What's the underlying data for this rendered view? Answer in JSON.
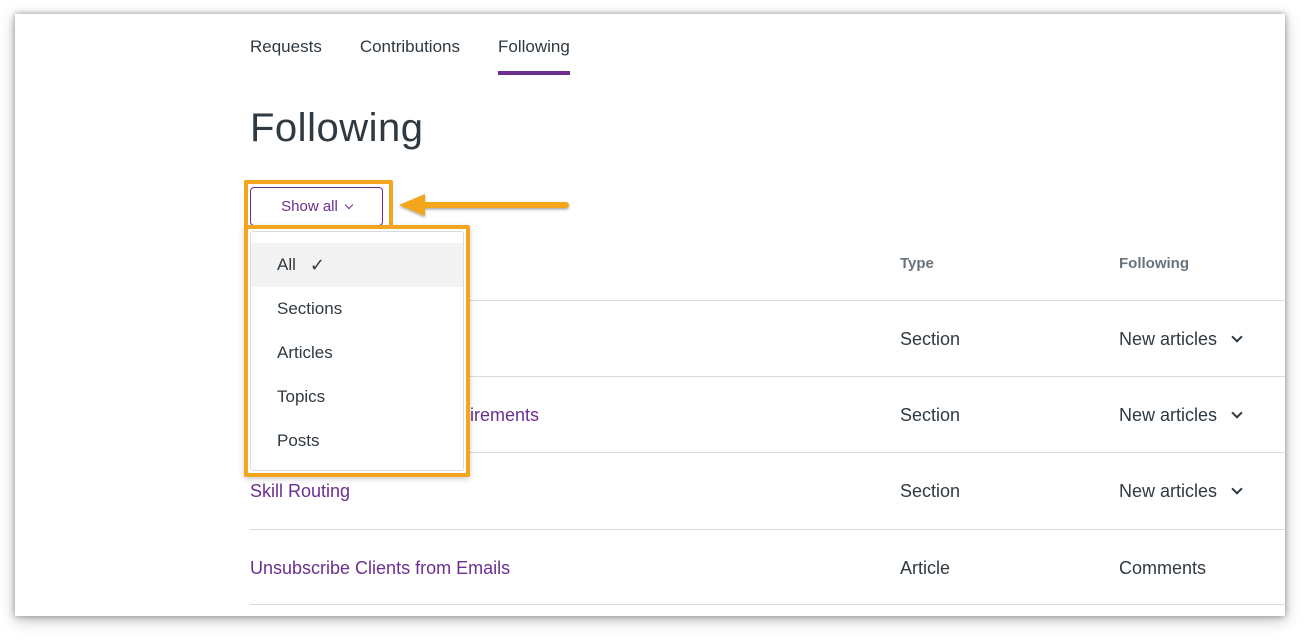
{
  "tabs": [
    {
      "label": "Requests"
    },
    {
      "label": "Contributions"
    },
    {
      "label": "Following",
      "active": true
    }
  ],
  "page_title": "Following",
  "filter": {
    "button_label": "Show all",
    "options": [
      {
        "label": "All",
        "checkmark": "✓",
        "selected": true
      },
      {
        "label": "Sections"
      },
      {
        "label": "Articles"
      },
      {
        "label": "Topics"
      },
      {
        "label": "Posts"
      }
    ]
  },
  "table": {
    "columns": {
      "type": "Type",
      "following": "Following"
    },
    "rows": [
      {
        "title": "",
        "type": "Section",
        "following": "New articles"
      },
      {
        "title": "uirements",
        "type": "Section",
        "following": "New articles"
      },
      {
        "title": "Skill Routing",
        "type": "Section",
        "following": "New articles"
      },
      {
        "title": "Unsubscribe Clients from Emails",
        "type": "Article",
        "following": "Comments"
      }
    ]
  },
  "colors": {
    "accent": "#6b2f8f",
    "annotation": "#f3a51d",
    "text": "#2f3941",
    "muted": "#68737d",
    "divider": "#d8dcde"
  }
}
